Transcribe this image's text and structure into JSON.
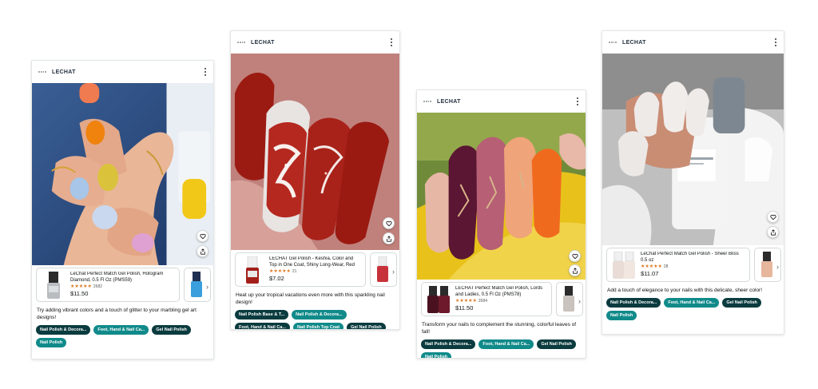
{
  "colors": {
    "pill_dark": "#0a3b3f",
    "pill_teal": "#118a8a",
    "star": "#de7921"
  },
  "cards": [
    {
      "brand": "LECHAT",
      "product": {
        "title": "LeChat Perfect Match Gel Polish, Hologram Diamond, 0.5 Fl Oz (PMS59)",
        "stars": "★★★★★",
        "rating_value": 4.5,
        "reviews": "2682",
        "price": "$11.50"
      },
      "caption": "Try adding vibrant colors and a touch of glitter to your marbling gel art designs!",
      "tags": [
        "Nail Polish & Decora...",
        "Foot, Hand & Nail Ca...",
        "Gel Nail Polish",
        "Nail Polish"
      ]
    },
    {
      "brand": "LECHAT",
      "product": {
        "title": "LECHAT Gel Polish - Keshia, Color and Top in One Coat, Shiny Long-Wear, Red Glitt...",
        "stars": "★★★★★",
        "rating_value": 4.5,
        "reviews": "21",
        "price": "$7.02"
      },
      "caption": "Heat up your tropical vacations even more with this sparkling nail design!",
      "tags": [
        "Nail Polish Base & T...",
        "Nail Polish & Decora...",
        "Foot, Hand & Nail Ca...",
        "Nail Polish Top Coat",
        "Gel Nail Polish"
      ]
    },
    {
      "brand": "LECHAT",
      "product": {
        "title": "LECHAT Perfect Match Gel Polish, Lords and Ladies, 0.5 Fl Oz (PMS78)",
        "stars": "★★★★★",
        "rating_value": 4.5,
        "reviews": "2684",
        "price": "$11.50"
      },
      "caption": "Transform your nails to complement the stunning, colorful leaves of fall!",
      "tags": [
        "Nail Polish & Decora...",
        "Foot, Hand & Nail Ca...",
        "Gel Nail Polish",
        "Nail Polish"
      ]
    },
    {
      "brand": "LECHAT",
      "product": {
        "title": "LeChat Perfect Match Gel Polish - Sheer Bliss 0.5 oz",
        "stars": "★★★★★",
        "rating_value": 4.5,
        "reviews": "28",
        "price": "$11.07"
      },
      "caption": "Add a touch of elegance to your nails with this delicate, sheer color!",
      "tags": [
        "Nail Polish & Decora...",
        "Foot, Hand & Nail Ca...",
        "Gel Nail Polish",
        "Nail Polish"
      ]
    }
  ]
}
